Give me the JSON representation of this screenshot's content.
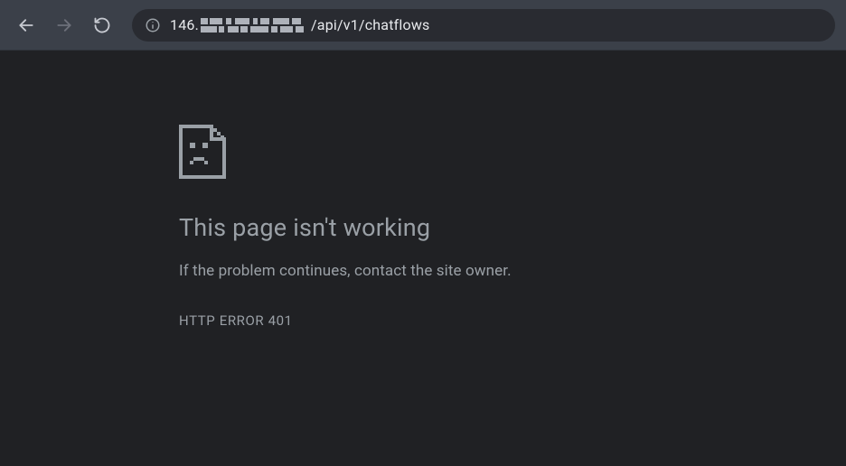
{
  "toolbar": {
    "back_enabled": true,
    "forward_enabled": false,
    "url_prefix": "146.",
    "url_suffix": "/api/v1/chatflows"
  },
  "error": {
    "title": "This page isn't working",
    "message": "If the problem continues, contact the site owner.",
    "code": "HTTP ERROR 401"
  }
}
